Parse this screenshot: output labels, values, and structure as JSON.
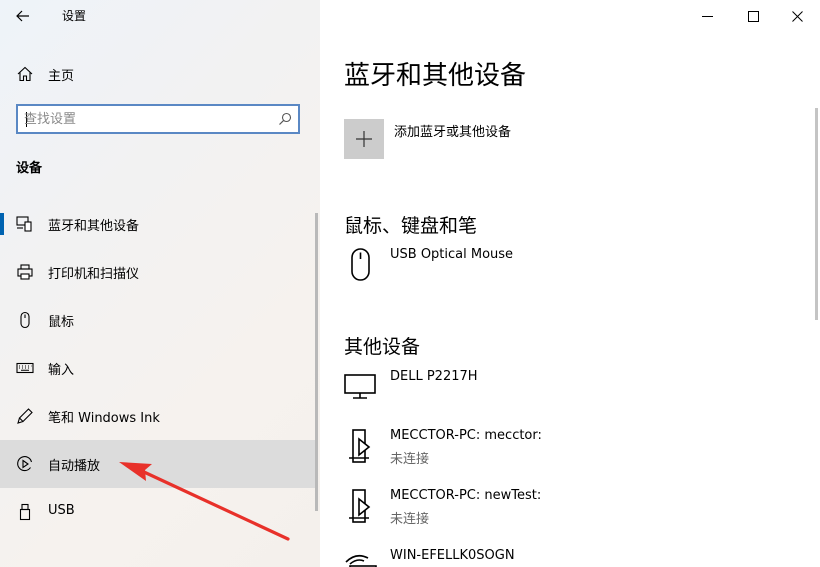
{
  "window": {
    "title": "设置",
    "controls": {
      "minimize": "minimize-icon",
      "maximize": "maximize-icon",
      "close": "close-icon"
    }
  },
  "nav": {
    "back_icon": "arrow-left-icon",
    "home": {
      "label": "主页",
      "icon": "home-icon"
    },
    "search": {
      "placeholder": "查找设置",
      "icon": "search-icon"
    },
    "section": "设备",
    "items": [
      {
        "label": "蓝牙和其他设备",
        "icon": "bluetooth-devices-icon",
        "selected": true
      },
      {
        "label": "打印机和扫描仪",
        "icon": "printer-icon"
      },
      {
        "label": "鼠标",
        "icon": "mouse-icon"
      },
      {
        "label": "输入",
        "icon": "keyboard-icon"
      },
      {
        "label": "笔和 Windows Ink",
        "icon": "pen-icon"
      },
      {
        "label": "自动播放",
        "icon": "autoplay-icon",
        "hovered": true
      },
      {
        "label": "USB",
        "icon": "usb-icon"
      }
    ]
  },
  "main": {
    "title": "蓝牙和其他设备",
    "add_device": {
      "label": "添加蓝牙或其他设备",
      "icon": "plus-icon"
    },
    "groups": [
      {
        "header": "鼠标、键盘和笔",
        "devices": [
          {
            "name": "USB Optical Mouse",
            "status": "",
            "icon": "mouse-icon"
          }
        ]
      },
      {
        "header": "其他设备",
        "devices": [
          {
            "name": "DELL P2217H",
            "status": "",
            "icon": "monitor-icon"
          },
          {
            "name": "MECCTOR-PC: mecctor:",
            "status": "未连接",
            "icon": "media-device-icon"
          },
          {
            "name": "MECCTOR-PC: newTest:",
            "status": "未连接",
            "icon": "media-device-icon"
          },
          {
            "name": "WIN-EFELLK0SOGN",
            "status": "",
            "icon": "network-device-icon"
          }
        ]
      }
    ]
  },
  "colors": {
    "accent": "#0063b1",
    "annotation": "#e8312a",
    "search_border": "#5a88c4"
  }
}
